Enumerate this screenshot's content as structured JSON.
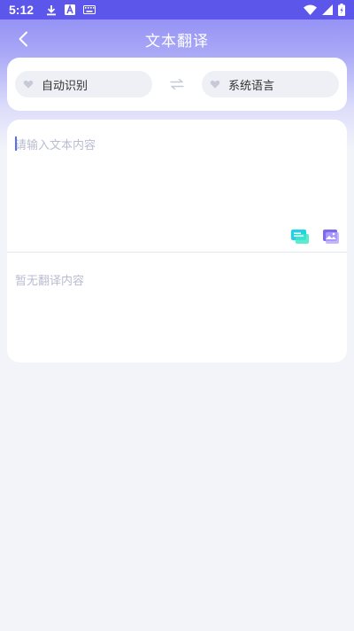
{
  "status_bar": {
    "time": "5:12",
    "icons": [
      "download-icon",
      "font-a-icon",
      "keyboard-icon",
      "wifi-icon",
      "signal-icon",
      "battery-icon"
    ]
  },
  "header": {
    "title": "文本翻译",
    "back_icon": "chevron-left-icon"
  },
  "languages": {
    "source": "自动识别",
    "target": "系统语言",
    "swap_icon": "swap-arrows-icon"
  },
  "input": {
    "placeholder": "请输入文本内容",
    "value": ""
  },
  "tools": {
    "text_tool_icon": "text-card-icon",
    "image_tool_icon": "image-icon"
  },
  "result": {
    "empty_text": "暂无翻译内容"
  },
  "colors": {
    "accent": "#5d56ea",
    "header_gradient_top": "#8a86f4",
    "background": "#f3f4fa",
    "placeholder": "#b8bcd0",
    "text_tool": "#1fd2e6",
    "image_tool": "#7c68f2"
  }
}
